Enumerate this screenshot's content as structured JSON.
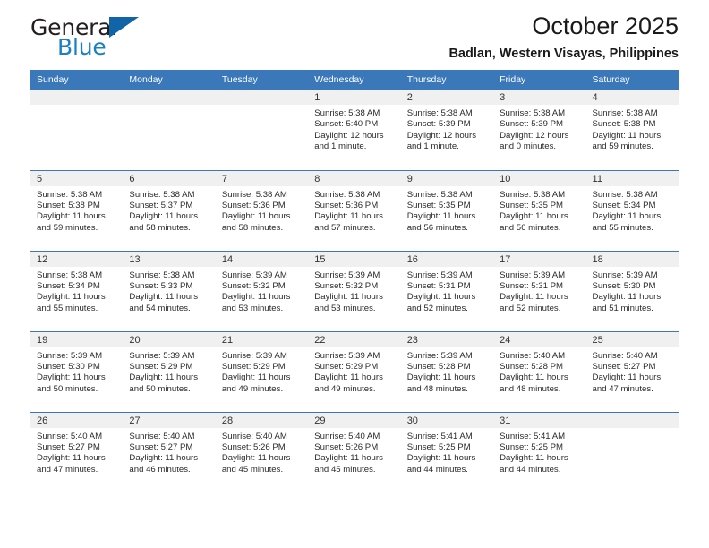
{
  "brand": {
    "name_top": "General",
    "name_bottom": "Blue",
    "triangle_icon": "triangle-icon",
    "accent_color": "#1264a8",
    "text_color": "#231f20"
  },
  "header": {
    "title": "October 2025",
    "subtitle": "Badlan, Western Visayas, Philippines"
  },
  "calendar": {
    "header_bg": "#3a78ba",
    "daynum_bg": "#f0f0f0",
    "weekdays": [
      "Sunday",
      "Monday",
      "Tuesday",
      "Wednesday",
      "Thursday",
      "Friday",
      "Saturday"
    ],
    "weeks": [
      [
        {
          "day": "",
          "sunrise": "",
          "sunset": "",
          "daylight_1": "",
          "daylight_2": ""
        },
        {
          "day": "",
          "sunrise": "",
          "sunset": "",
          "daylight_1": "",
          "daylight_2": ""
        },
        {
          "day": "",
          "sunrise": "",
          "sunset": "",
          "daylight_1": "",
          "daylight_2": ""
        },
        {
          "day": "1",
          "sunrise": "Sunrise: 5:38 AM",
          "sunset": "Sunset: 5:40 PM",
          "daylight_1": "Daylight: 12 hours",
          "daylight_2": "and 1 minute."
        },
        {
          "day": "2",
          "sunrise": "Sunrise: 5:38 AM",
          "sunset": "Sunset: 5:39 PM",
          "daylight_1": "Daylight: 12 hours",
          "daylight_2": "and 1 minute."
        },
        {
          "day": "3",
          "sunrise": "Sunrise: 5:38 AM",
          "sunset": "Sunset: 5:39 PM",
          "daylight_1": "Daylight: 12 hours",
          "daylight_2": "and 0 minutes."
        },
        {
          "day": "4",
          "sunrise": "Sunrise: 5:38 AM",
          "sunset": "Sunset: 5:38 PM",
          "daylight_1": "Daylight: 11 hours",
          "daylight_2": "and 59 minutes."
        }
      ],
      [
        {
          "day": "5",
          "sunrise": "Sunrise: 5:38 AM",
          "sunset": "Sunset: 5:38 PM",
          "daylight_1": "Daylight: 11 hours",
          "daylight_2": "and 59 minutes."
        },
        {
          "day": "6",
          "sunrise": "Sunrise: 5:38 AM",
          "sunset": "Sunset: 5:37 PM",
          "daylight_1": "Daylight: 11 hours",
          "daylight_2": "and 58 minutes."
        },
        {
          "day": "7",
          "sunrise": "Sunrise: 5:38 AM",
          "sunset": "Sunset: 5:36 PM",
          "daylight_1": "Daylight: 11 hours",
          "daylight_2": "and 58 minutes."
        },
        {
          "day": "8",
          "sunrise": "Sunrise: 5:38 AM",
          "sunset": "Sunset: 5:36 PM",
          "daylight_1": "Daylight: 11 hours",
          "daylight_2": "and 57 minutes."
        },
        {
          "day": "9",
          "sunrise": "Sunrise: 5:38 AM",
          "sunset": "Sunset: 5:35 PM",
          "daylight_1": "Daylight: 11 hours",
          "daylight_2": "and 56 minutes."
        },
        {
          "day": "10",
          "sunrise": "Sunrise: 5:38 AM",
          "sunset": "Sunset: 5:35 PM",
          "daylight_1": "Daylight: 11 hours",
          "daylight_2": "and 56 minutes."
        },
        {
          "day": "11",
          "sunrise": "Sunrise: 5:38 AM",
          "sunset": "Sunset: 5:34 PM",
          "daylight_1": "Daylight: 11 hours",
          "daylight_2": "and 55 minutes."
        }
      ],
      [
        {
          "day": "12",
          "sunrise": "Sunrise: 5:38 AM",
          "sunset": "Sunset: 5:34 PM",
          "daylight_1": "Daylight: 11 hours",
          "daylight_2": "and 55 minutes."
        },
        {
          "day": "13",
          "sunrise": "Sunrise: 5:38 AM",
          "sunset": "Sunset: 5:33 PM",
          "daylight_1": "Daylight: 11 hours",
          "daylight_2": "and 54 minutes."
        },
        {
          "day": "14",
          "sunrise": "Sunrise: 5:39 AM",
          "sunset": "Sunset: 5:32 PM",
          "daylight_1": "Daylight: 11 hours",
          "daylight_2": "and 53 minutes."
        },
        {
          "day": "15",
          "sunrise": "Sunrise: 5:39 AM",
          "sunset": "Sunset: 5:32 PM",
          "daylight_1": "Daylight: 11 hours",
          "daylight_2": "and 53 minutes."
        },
        {
          "day": "16",
          "sunrise": "Sunrise: 5:39 AM",
          "sunset": "Sunset: 5:31 PM",
          "daylight_1": "Daylight: 11 hours",
          "daylight_2": "and 52 minutes."
        },
        {
          "day": "17",
          "sunrise": "Sunrise: 5:39 AM",
          "sunset": "Sunset: 5:31 PM",
          "daylight_1": "Daylight: 11 hours",
          "daylight_2": "and 52 minutes."
        },
        {
          "day": "18",
          "sunrise": "Sunrise: 5:39 AM",
          "sunset": "Sunset: 5:30 PM",
          "daylight_1": "Daylight: 11 hours",
          "daylight_2": "and 51 minutes."
        }
      ],
      [
        {
          "day": "19",
          "sunrise": "Sunrise: 5:39 AM",
          "sunset": "Sunset: 5:30 PM",
          "daylight_1": "Daylight: 11 hours",
          "daylight_2": "and 50 minutes."
        },
        {
          "day": "20",
          "sunrise": "Sunrise: 5:39 AM",
          "sunset": "Sunset: 5:29 PM",
          "daylight_1": "Daylight: 11 hours",
          "daylight_2": "and 50 minutes."
        },
        {
          "day": "21",
          "sunrise": "Sunrise: 5:39 AM",
          "sunset": "Sunset: 5:29 PM",
          "daylight_1": "Daylight: 11 hours",
          "daylight_2": "and 49 minutes."
        },
        {
          "day": "22",
          "sunrise": "Sunrise: 5:39 AM",
          "sunset": "Sunset: 5:29 PM",
          "daylight_1": "Daylight: 11 hours",
          "daylight_2": "and 49 minutes."
        },
        {
          "day": "23",
          "sunrise": "Sunrise: 5:39 AM",
          "sunset": "Sunset: 5:28 PM",
          "daylight_1": "Daylight: 11 hours",
          "daylight_2": "and 48 minutes."
        },
        {
          "day": "24",
          "sunrise": "Sunrise: 5:40 AM",
          "sunset": "Sunset: 5:28 PM",
          "daylight_1": "Daylight: 11 hours",
          "daylight_2": "and 48 minutes."
        },
        {
          "day": "25",
          "sunrise": "Sunrise: 5:40 AM",
          "sunset": "Sunset: 5:27 PM",
          "daylight_1": "Daylight: 11 hours",
          "daylight_2": "and 47 minutes."
        }
      ],
      [
        {
          "day": "26",
          "sunrise": "Sunrise: 5:40 AM",
          "sunset": "Sunset: 5:27 PM",
          "daylight_1": "Daylight: 11 hours",
          "daylight_2": "and 47 minutes."
        },
        {
          "day": "27",
          "sunrise": "Sunrise: 5:40 AM",
          "sunset": "Sunset: 5:27 PM",
          "daylight_1": "Daylight: 11 hours",
          "daylight_2": "and 46 minutes."
        },
        {
          "day": "28",
          "sunrise": "Sunrise: 5:40 AM",
          "sunset": "Sunset: 5:26 PM",
          "daylight_1": "Daylight: 11 hours",
          "daylight_2": "and 45 minutes."
        },
        {
          "day": "29",
          "sunrise": "Sunrise: 5:40 AM",
          "sunset": "Sunset: 5:26 PM",
          "daylight_1": "Daylight: 11 hours",
          "daylight_2": "and 45 minutes."
        },
        {
          "day": "30",
          "sunrise": "Sunrise: 5:41 AM",
          "sunset": "Sunset: 5:25 PM",
          "daylight_1": "Daylight: 11 hours",
          "daylight_2": "and 44 minutes."
        },
        {
          "day": "31",
          "sunrise": "Sunrise: 5:41 AM",
          "sunset": "Sunset: 5:25 PM",
          "daylight_1": "Daylight: 11 hours",
          "daylight_2": "and 44 minutes."
        },
        {
          "day": "",
          "sunrise": "",
          "sunset": "",
          "daylight_1": "",
          "daylight_2": ""
        }
      ]
    ]
  }
}
